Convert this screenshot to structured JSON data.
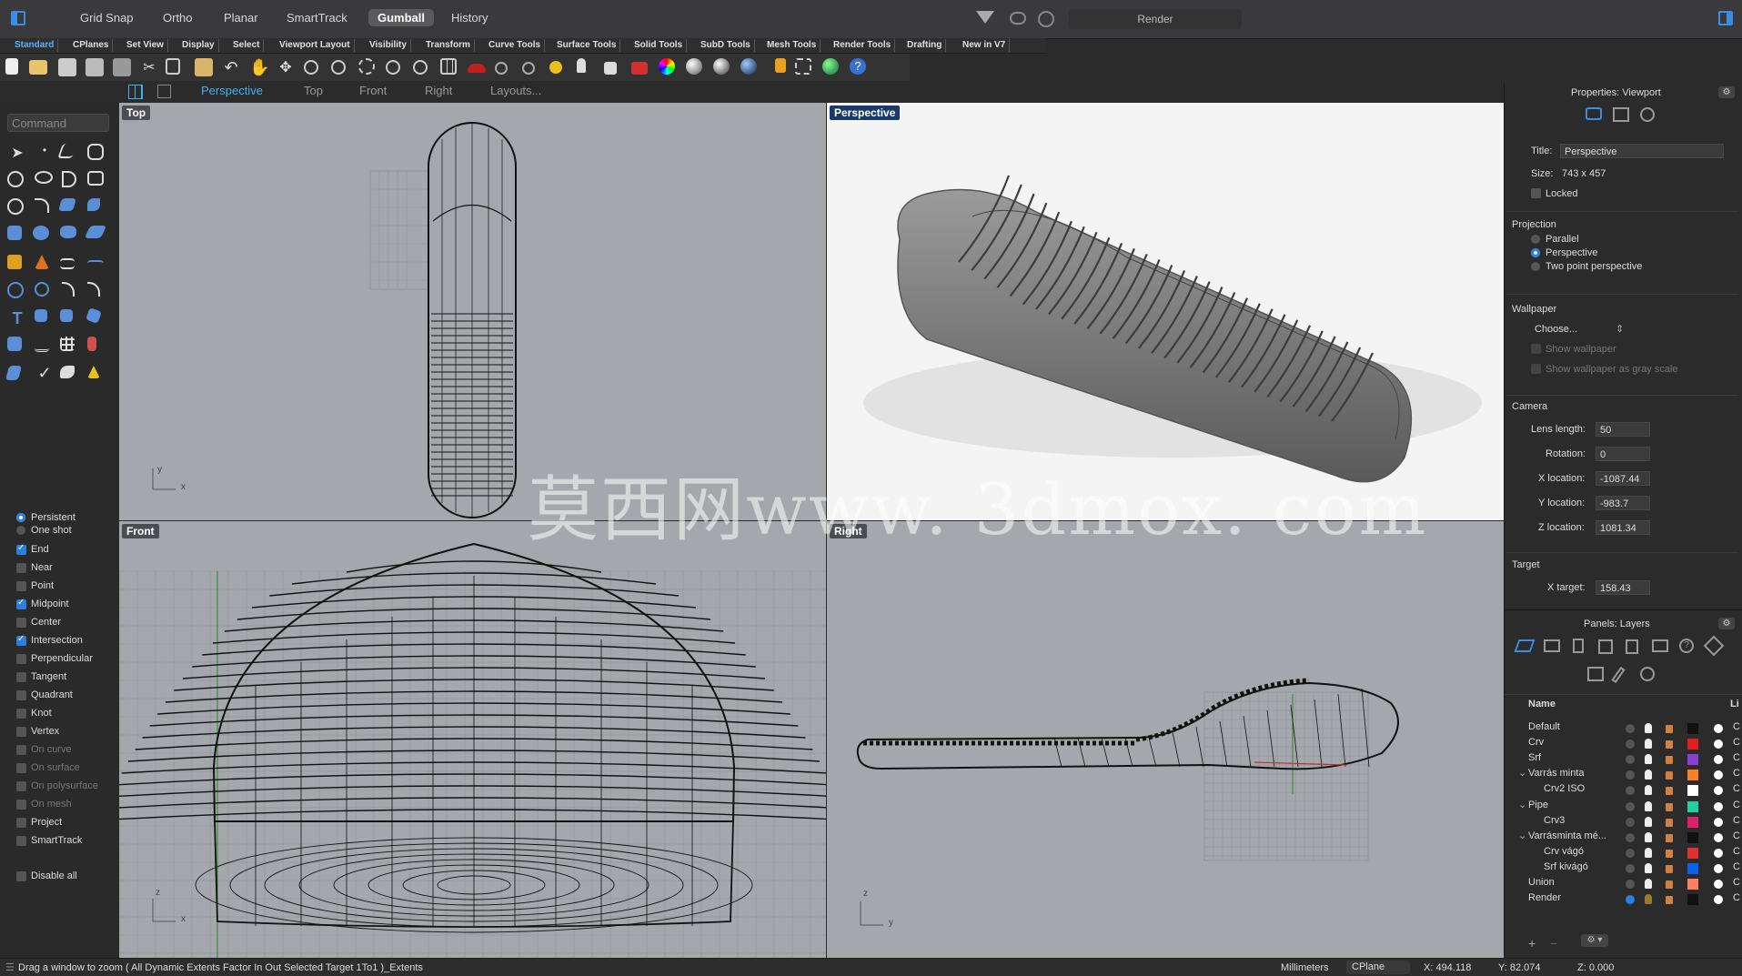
{
  "top_bar": {
    "modes": [
      "Grid Snap",
      "Ortho",
      "Planar",
      "SmartTrack",
      "Gumball",
      "History"
    ],
    "active_mode": "Gumball",
    "render_label": "Render"
  },
  "tabs": [
    "Standard",
    "CPlanes",
    "Set View",
    "Display",
    "Select",
    "Viewport Layout",
    "Visibility",
    "Transform",
    "Curve Tools",
    "Surface Tools",
    "Solid Tools",
    "SubD Tools",
    "Mesh Tools",
    "Render Tools",
    "Drafting",
    "New in V7"
  ],
  "active_tab": "Standard",
  "viewport_tabs": [
    "Perspective",
    "Top",
    "Front",
    "Right",
    "Layouts..."
  ],
  "active_viewport_tab": "Perspective",
  "command_placeholder": "Command",
  "viewports": {
    "top": {
      "label": "Top",
      "axis_x": "x",
      "axis_y": "y"
    },
    "perspective": {
      "label": "Perspective"
    },
    "front": {
      "label": "Front",
      "axis_x": "x",
      "axis_y": "z"
    },
    "right": {
      "label": "Right",
      "axis_x": "y",
      "axis_y": "z"
    }
  },
  "osnap": {
    "persistent": "Persistent",
    "one_shot": "One shot",
    "items": [
      {
        "label": "End",
        "checked": true,
        "dim": false
      },
      {
        "label": "Near",
        "checked": false,
        "dim": false
      },
      {
        "label": "Point",
        "checked": false,
        "dim": false
      },
      {
        "label": "Midpoint",
        "checked": true,
        "dim": false
      },
      {
        "label": "Center",
        "checked": false,
        "dim": false
      },
      {
        "label": "Intersection",
        "checked": true,
        "dim": false
      },
      {
        "label": "Perpendicular",
        "checked": false,
        "dim": false
      },
      {
        "label": "Tangent",
        "checked": false,
        "dim": false
      },
      {
        "label": "Quadrant",
        "checked": false,
        "dim": false
      },
      {
        "label": "Knot",
        "checked": false,
        "dim": false
      },
      {
        "label": "Vertex",
        "checked": false,
        "dim": false
      },
      {
        "label": "On curve",
        "checked": false,
        "dim": true
      },
      {
        "label": "On surface",
        "checked": false,
        "dim": true
      },
      {
        "label": "On polysurface",
        "checked": false,
        "dim": true
      },
      {
        "label": "On mesh",
        "checked": false,
        "dim": true
      },
      {
        "label": "Project",
        "checked": false,
        "dim": false
      },
      {
        "label": "SmartTrack",
        "checked": false,
        "dim": false
      }
    ],
    "disable_all": "Disable all"
  },
  "properties": {
    "header": "Properties: Viewport",
    "title_label": "Title:",
    "title_value": "Perspective",
    "size_label": "Size:",
    "size_value": "743 x 457",
    "locked": "Locked",
    "projection": "Projection",
    "parallel": "Parallel",
    "perspective": "Perspective",
    "two_point": "Two point perspective",
    "wallpaper": "Wallpaper",
    "choose": "Choose...",
    "show_wallpaper": "Show wallpaper",
    "show_gray": "Show wallpaper as gray scale",
    "camera": "Camera",
    "lens_label": "Lens length:",
    "lens_value": "50",
    "rotation_label": "Rotation:",
    "rotation_value": "0",
    "xloc_label": "X location:",
    "xloc_value": "-1087.44",
    "yloc_label": "Y location:",
    "yloc_value": "-983.7",
    "zloc_label": "Z location:",
    "zloc_value": "1081.34",
    "target": "Target",
    "xtarget_label": "X target:",
    "xtarget_value": "158.43"
  },
  "layers": {
    "header": "Panels: Layers",
    "name_col": "Name",
    "rows": [
      {
        "name": "Default",
        "indent": 0,
        "color": "#111111",
        "expander": ""
      },
      {
        "name": "Crv",
        "indent": 0,
        "color": "#e02020",
        "expander": ""
      },
      {
        "name": "Srf",
        "indent": 0,
        "color": "#8a3fd0",
        "expander": ""
      },
      {
        "name": "Varrás minta",
        "indent": 0,
        "color": "#ff7f27",
        "expander": "⌄"
      },
      {
        "name": "Crv2 ISO",
        "indent": 1,
        "color": "#ffffff",
        "expander": ""
      },
      {
        "name": "Pipe",
        "indent": 0,
        "color": "#20d0a0",
        "expander": "⌄"
      },
      {
        "name": "Crv3",
        "indent": 1,
        "color": "#e0206a",
        "expander": ""
      },
      {
        "name": "Varrásminta mé...",
        "indent": 0,
        "color": "#111111",
        "expander": "⌄"
      },
      {
        "name": "Crv vágó",
        "indent": 1,
        "color": "#e03030",
        "expander": ""
      },
      {
        "name": "Srf kivágó",
        "indent": 1,
        "color": "#1060f0",
        "expander": ""
      },
      {
        "name": "Union",
        "indent": 0,
        "color": "#ff8060",
        "expander": ""
      },
      {
        "name": "Render",
        "indent": 0,
        "color": "#111111",
        "expander": ""
      }
    ]
  },
  "status": {
    "message": "Drag a window to zoom ( All Dynamic Extents Factor In Out Selected Target 1To1 )_Extents",
    "units": "Millimeters",
    "cplane": "CPlane",
    "x": "X: 494.118",
    "y": "Y: 82.074",
    "z": "Z: 0.000"
  },
  "watermark": "莫西网www. 3dmox. com"
}
